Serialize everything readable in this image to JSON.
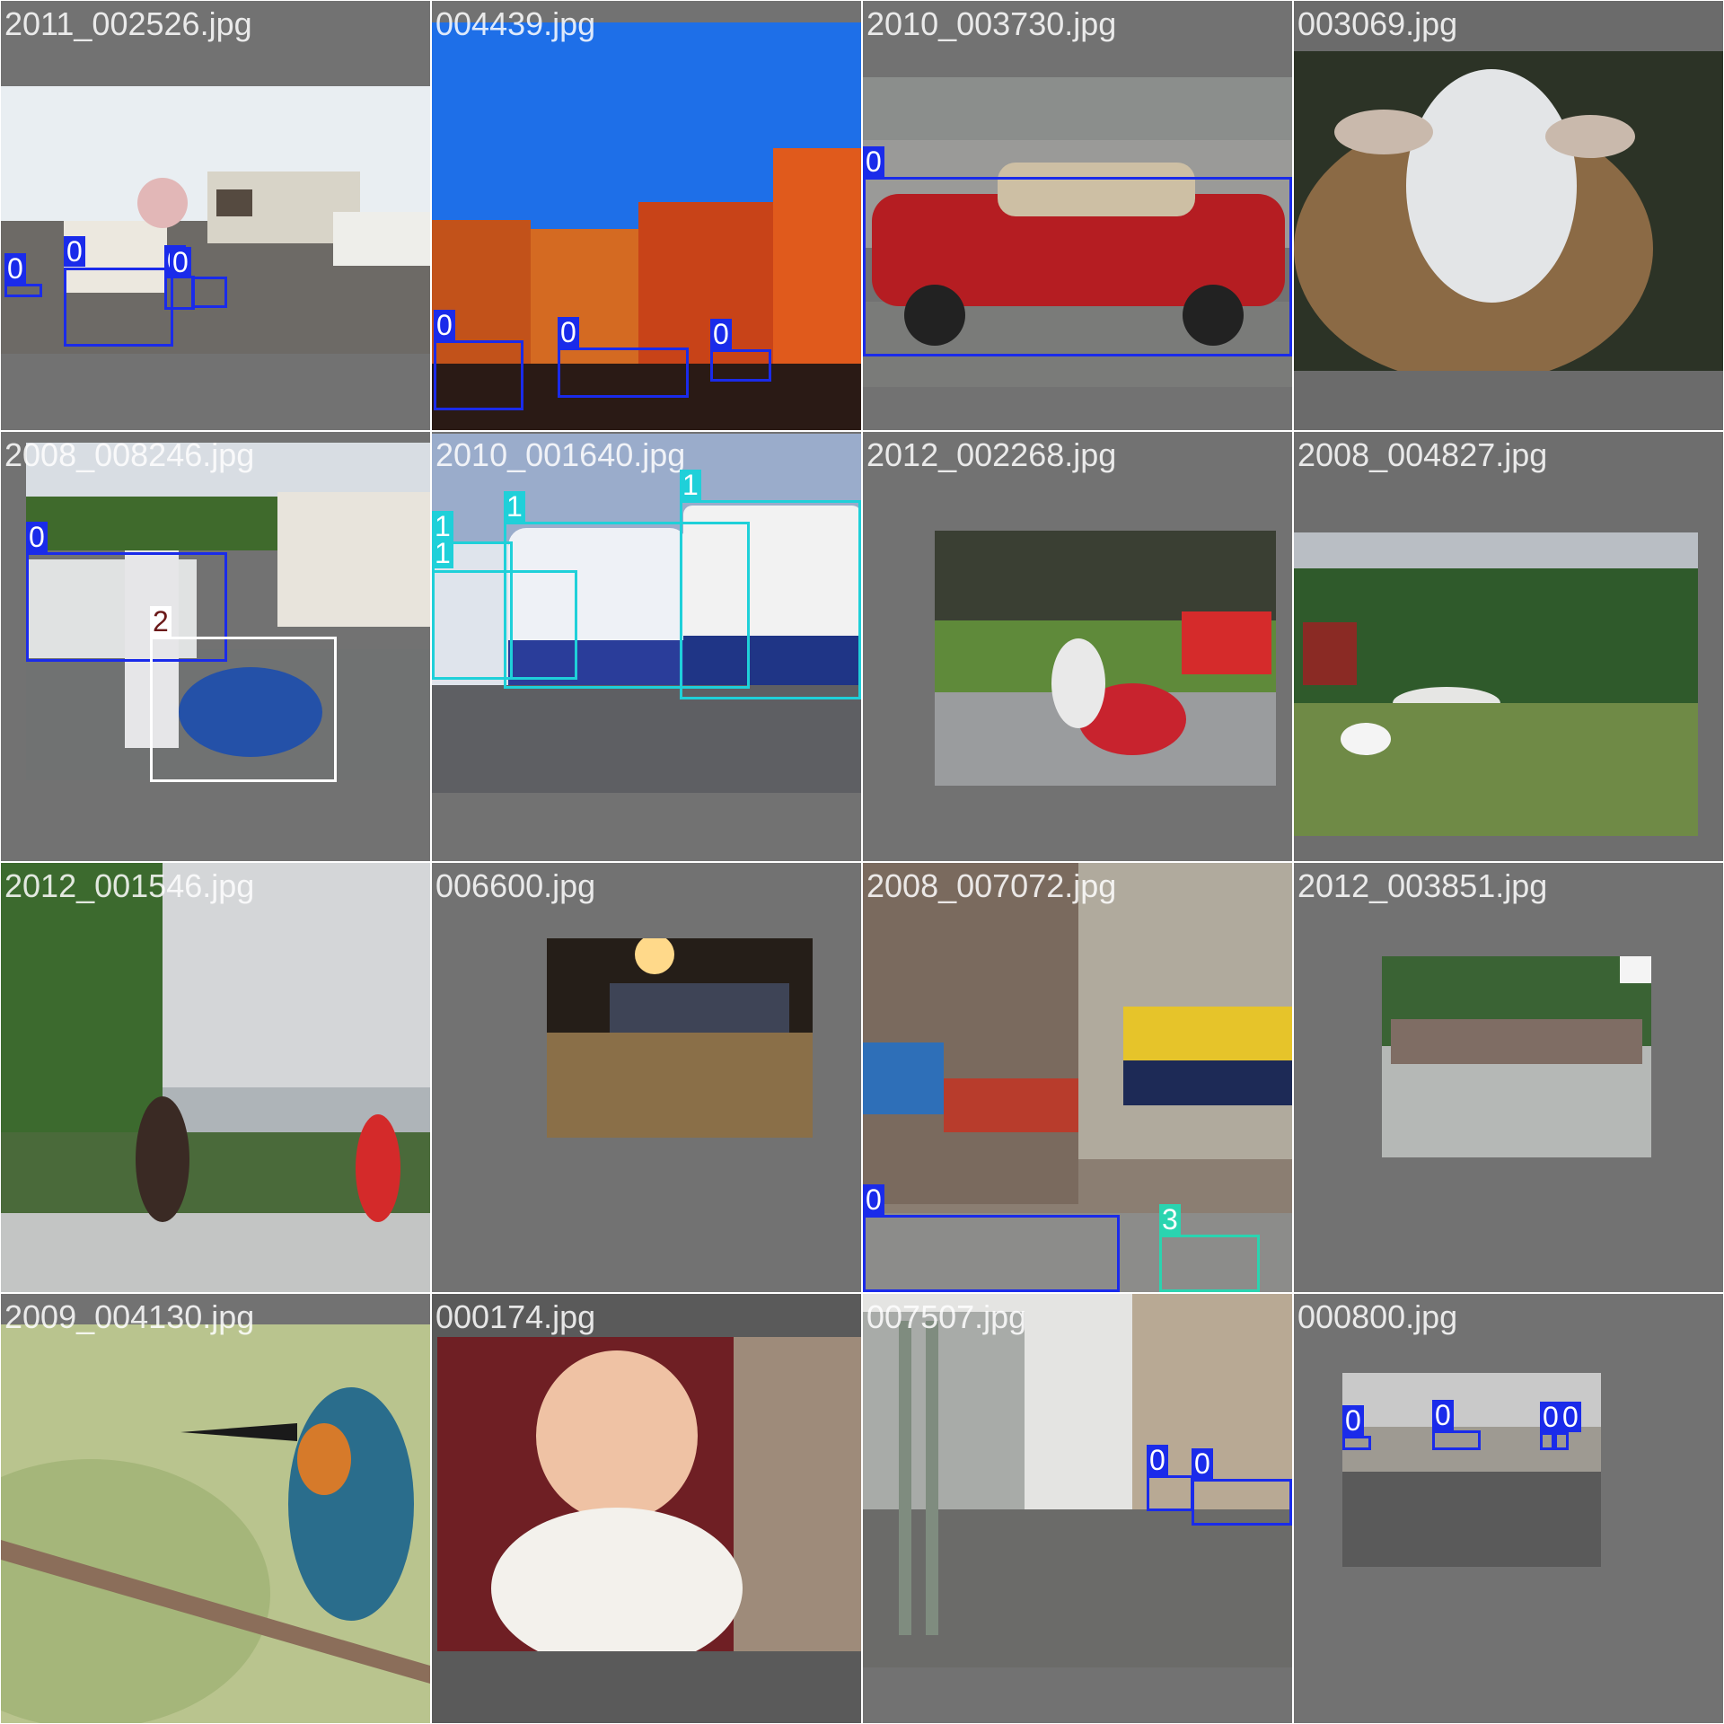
{
  "mosaic": {
    "tiles": [
      {
        "filename": "2011_002526.jpg",
        "labels": [
          "0",
          "0",
          "0",
          "0"
        ]
      },
      {
        "filename": "004439.jpg",
        "labels": [
          "0",
          "0",
          "0"
        ]
      },
      {
        "filename": "2010_003730.jpg",
        "labels": [
          "0"
        ]
      },
      {
        "filename": "003069.jpg",
        "labels": []
      },
      {
        "filename": "2008_008246.jpg",
        "labels": [
          "0",
          "2"
        ]
      },
      {
        "filename": "2010_001640.jpg",
        "labels": [
          "1",
          "1",
          "1",
          "1"
        ]
      },
      {
        "filename": "2012_002268.jpg",
        "labels": []
      },
      {
        "filename": "2008_004827.jpg",
        "labels": []
      },
      {
        "filename": "2012_001546.jpg",
        "labels": []
      },
      {
        "filename": "006600.jpg",
        "labels": []
      },
      {
        "filename": "2008_007072.jpg",
        "labels": [
          "0",
          "3"
        ]
      },
      {
        "filename": "2012_003851.jpg",
        "labels": []
      },
      {
        "filename": "2009_004130.jpg",
        "labels": []
      },
      {
        "filename": "000174.jpg",
        "labels": []
      },
      {
        "filename": "007507.jpg",
        "labels": [
          "0",
          "0"
        ]
      },
      {
        "filename": "000800.jpg",
        "labels": [
          "0",
          "0",
          "0",
          "0"
        ]
      }
    ]
  },
  "colors": {
    "class_0": "#1a2bea",
    "class_1": "#1fd0d9",
    "class_2": "#ffffff",
    "class_3": "#2ad4b0",
    "tile_background": "#727272"
  }
}
